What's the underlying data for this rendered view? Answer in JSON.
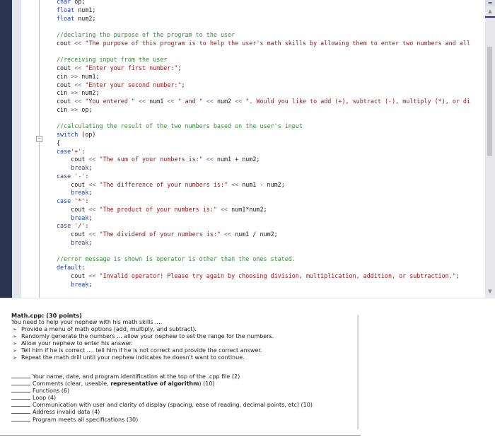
{
  "editor": {
    "lines": [
      {
        "parts": [
          [
            "kw",
            "cnar"
          ],
          [
            "id",
            " op;"
          ]
        ]
      },
      {
        "parts": [
          [
            "kw",
            "float"
          ],
          [
            "id",
            " num1;"
          ]
        ]
      },
      {
        "parts": [
          [
            "kw",
            "float"
          ],
          [
            "id",
            " num2;"
          ]
        ]
      },
      {
        "parts": []
      },
      {
        "parts": [
          [
            "cm",
            "//declaring the purpose of the program to the user"
          ]
        ]
      },
      {
        "parts": [
          [
            "id",
            "cout "
          ],
          [
            "op",
            "<<"
          ],
          [
            "str",
            " \"The purpose of this program is to help the user's math skills by allowing them to enter two numbers and all"
          ]
        ]
      },
      {
        "parts": []
      },
      {
        "parts": [
          [
            "cm",
            "//receiving input from the user"
          ]
        ]
      },
      {
        "parts": [
          [
            "id",
            "cout "
          ],
          [
            "op",
            "<<"
          ],
          [
            "str",
            " \"Enter your first number:\""
          ],
          [
            "id",
            ";"
          ]
        ]
      },
      {
        "parts": [
          [
            "id",
            "cin "
          ],
          [
            "op",
            ">>"
          ],
          [
            "id",
            " num1;"
          ]
        ]
      },
      {
        "parts": [
          [
            "id",
            "cout "
          ],
          [
            "op",
            "<<"
          ],
          [
            "str",
            " \"Enter your second number:\""
          ],
          [
            "id",
            ";"
          ]
        ]
      },
      {
        "parts": [
          [
            "id",
            "cin "
          ],
          [
            "op",
            ">>"
          ],
          [
            "id",
            " num2;"
          ]
        ]
      },
      {
        "parts": [
          [
            "id",
            "cout "
          ],
          [
            "op",
            "<<"
          ],
          [
            "str",
            " \"You entered \""
          ],
          [
            "op",
            " <<"
          ],
          [
            "id",
            " num1 "
          ],
          [
            "op",
            "<<"
          ],
          [
            "str",
            " \" and \""
          ],
          [
            "op",
            " <<"
          ],
          [
            "id",
            " num2 "
          ],
          [
            "op",
            "<<"
          ],
          [
            "str",
            " \". Would you like to add (+), subtract (-), multiply (*), or di"
          ]
        ]
      },
      {
        "parts": [
          [
            "id",
            "cin "
          ],
          [
            "op",
            ">>"
          ],
          [
            "id",
            " op;"
          ]
        ]
      },
      {
        "parts": []
      },
      {
        "parts": [
          [
            "cm",
            "//calculating the result of the two numbers based on the user's input"
          ]
        ]
      },
      {
        "parts": [
          [
            "kw",
            "switch"
          ],
          [
            "id",
            " (op)"
          ]
        ]
      },
      {
        "parts": [
          [
            "id",
            "{"
          ]
        ]
      },
      {
        "parts": [
          [
            "kw",
            "case"
          ],
          [
            "str",
            "'+'"
          ],
          [
            "id",
            ":"
          ]
        ]
      },
      {
        "parts": [
          [
            "id",
            "    cout "
          ],
          [
            "op",
            "<<"
          ],
          [
            "str",
            " \"The sum of your numbers is:\""
          ],
          [
            "op",
            " <<"
          ],
          [
            "id",
            " num1 + num2;"
          ]
        ]
      },
      {
        "parts": [
          [
            "kw",
            "    break"
          ],
          [
            "id",
            ";"
          ]
        ]
      },
      {
        "parts": [
          [
            "kw",
            "case"
          ],
          [
            "str",
            " '-'"
          ],
          [
            "id",
            ":"
          ]
        ]
      },
      {
        "parts": [
          [
            "id",
            "    cout "
          ],
          [
            "op",
            "<<"
          ],
          [
            "str",
            " \"The difference of your numbers is:\""
          ],
          [
            "op",
            " <<"
          ],
          [
            "id",
            " num1 - num2;"
          ]
        ]
      },
      {
        "parts": [
          [
            "kw",
            "    break"
          ],
          [
            "id",
            ";"
          ]
        ]
      },
      {
        "parts": [
          [
            "kw",
            "case"
          ],
          [
            "str",
            " '*'"
          ],
          [
            "id",
            ":"
          ]
        ]
      },
      {
        "parts": [
          [
            "id",
            "    cout "
          ],
          [
            "op",
            "<<"
          ],
          [
            "str",
            " \"The product of your numbers is:\""
          ],
          [
            "op",
            " <<"
          ],
          [
            "id",
            " num1*num2;"
          ]
        ]
      },
      {
        "parts": [
          [
            "kw",
            "    break"
          ],
          [
            "id",
            ";"
          ]
        ]
      },
      {
        "parts": [
          [
            "kw",
            "case"
          ],
          [
            "str",
            " '/'"
          ],
          [
            "id",
            ":"
          ]
        ]
      },
      {
        "parts": [
          [
            "id",
            "    cout "
          ],
          [
            "op",
            "<<"
          ],
          [
            "str",
            " \"The dividend of your numbers is:\""
          ],
          [
            "op",
            " <<"
          ],
          [
            "id",
            " num1 / num2;"
          ]
        ]
      },
      {
        "parts": [
          [
            "kw",
            "    break"
          ],
          [
            "id",
            ";"
          ]
        ]
      },
      {
        "parts": []
      },
      {
        "parts": [
          [
            "cm",
            "//error message is shown is operator is other than the ones stated."
          ]
        ]
      },
      {
        "parts": [
          [
            "kw",
            "default"
          ],
          [
            "id",
            ":"
          ]
        ]
      },
      {
        "parts": [
          [
            "id",
            "    cout "
          ],
          [
            "op",
            "<<"
          ],
          [
            "str",
            " \"Invalid operator! Please try again by choosing division, multiplication, addition, or subtraction.\""
          ],
          [
            "id",
            ";"
          ]
        ]
      },
      {
        "parts": [
          [
            "kw",
            "    break"
          ],
          [
            "id",
            ";"
          ]
        ]
      }
    ],
    "fold_icon": "collapse-minus-icon",
    "scrollbar": {
      "split_icon": "split-window-icon",
      "split_glyph": "═",
      "up_glyph": "▲",
      "down_glyph": "▼"
    }
  },
  "assignment": {
    "title": "Math.cpp: (30 points)",
    "intro": "You need to help your nephew with his math skills ....",
    "bullet_glyph": "➢",
    "bullets": [
      "Provide a menu of math options (add, multiply, and subtract).",
      "Randomly generate the numbers ... allow your nephew to set the range for the numbers.",
      "Allow your nephew to enter his answer.",
      "Tell him if he is correct .... tell him if he is not correct and provide the correct answer.",
      "Repeat the math drill until your nephew indicates he doesn't want to continue."
    ],
    "rubric": [
      {
        "pre": "Your name, date, and program identification at the top of the .cpp file (2)",
        "bold": "",
        "post": ""
      },
      {
        "pre": "Comments (clear, useable, ",
        "bold": "representative of algorithm",
        "post": ") (10)"
      },
      {
        "pre": "Functions (6)",
        "bold": "",
        "post": ""
      },
      {
        "pre": "Loop (4)",
        "bold": "",
        "post": ""
      },
      {
        "pre": "Communication with user and clarity of display (spacing, ease of reading, decimal points, etc) (10)",
        "bold": "",
        "post": ""
      },
      {
        "pre": "Address invalid data (4)",
        "bold": "",
        "post": ""
      },
      {
        "pre": "Program meets all specifications (30)",
        "bold": "",
        "post": ""
      }
    ]
  }
}
